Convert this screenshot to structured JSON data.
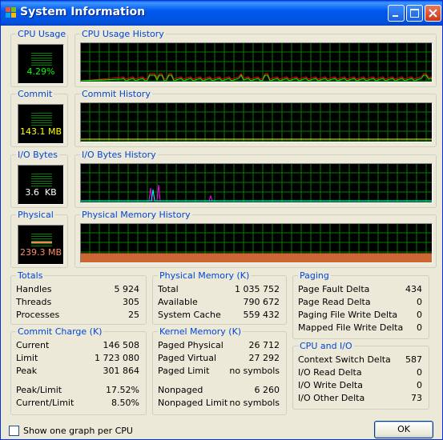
{
  "window": {
    "title": "System Information"
  },
  "cpu": {
    "label": "CPU Usage",
    "value": "4.29%",
    "history_label": "CPU Usage History"
  },
  "commit": {
    "label": "Commit",
    "value": "143.1 MB",
    "history_label": "Commit History"
  },
  "io": {
    "label": "I/O Bytes",
    "value": "3.6  KB",
    "history_label": "I/O Bytes History"
  },
  "physical": {
    "label": "Physical",
    "value": "239.3 MB",
    "history_label": "Physical Memory History"
  },
  "totals": {
    "label": "Totals",
    "rows": [
      {
        "k": "Handles",
        "v": "5 924"
      },
      {
        "k": "Threads",
        "v": "305"
      },
      {
        "k": "Processes",
        "v": "25"
      }
    ]
  },
  "commit_charge": {
    "label": "Commit Charge (K)",
    "rows": [
      {
        "k": "Current",
        "v": "146 508"
      },
      {
        "k": "Limit",
        "v": "1 723 080"
      },
      {
        "k": "Peak",
        "v": "301 864"
      }
    ],
    "rows2": [
      {
        "k": "Peak/Limit",
        "v": "17.52%"
      },
      {
        "k": "Current/Limit",
        "v": "8.50%"
      }
    ]
  },
  "physical_memory": {
    "label": "Physical Memory (K)",
    "rows": [
      {
        "k": "Total",
        "v": "1 035 752"
      },
      {
        "k": "Available",
        "v": "790 672"
      },
      {
        "k": "System Cache",
        "v": "559 432"
      }
    ]
  },
  "kernel_memory": {
    "label": "Kernel Memory (K)",
    "rows": [
      {
        "k": "Paged Physical",
        "v": "26 712"
      },
      {
        "k": "Paged Virtual",
        "v": "27 292"
      },
      {
        "k": "Paged Limit",
        "v": "no symbols"
      }
    ],
    "rows2": [
      {
        "k": "Nonpaged",
        "v": "6 260"
      },
      {
        "k": "Nonpaged Limit",
        "v": "no symbols"
      }
    ]
  },
  "paging": {
    "label": "Paging",
    "rows": [
      {
        "k": "Page Fault Delta",
        "v": "434"
      },
      {
        "k": "Page Read Delta",
        "v": "0"
      },
      {
        "k": "Paging File Write Delta",
        "v": "0"
      },
      {
        "k": "Mapped File Write Delta",
        "v": "0"
      }
    ]
  },
  "cpu_io": {
    "label": "CPU and I/O",
    "rows": [
      {
        "k": "Context Switch Delta",
        "v": "587"
      },
      {
        "k": "I/O Read Delta",
        "v": "0"
      },
      {
        "k": "I/O Write Delta",
        "v": "0"
      },
      {
        "k": "I/O Other Delta",
        "v": "73"
      }
    ]
  },
  "footer": {
    "checkbox_label": "Show one graph per CPU",
    "ok_label": "OK"
  },
  "colors": {
    "grid": "#008000",
    "cpu_line": "#ff0000",
    "cpu_kernel": "#00ff00",
    "commit_line": "#ffff00",
    "io_read": "#ff00ff",
    "io_write": "#00ffff",
    "physical_fill": "#cc6633"
  }
}
